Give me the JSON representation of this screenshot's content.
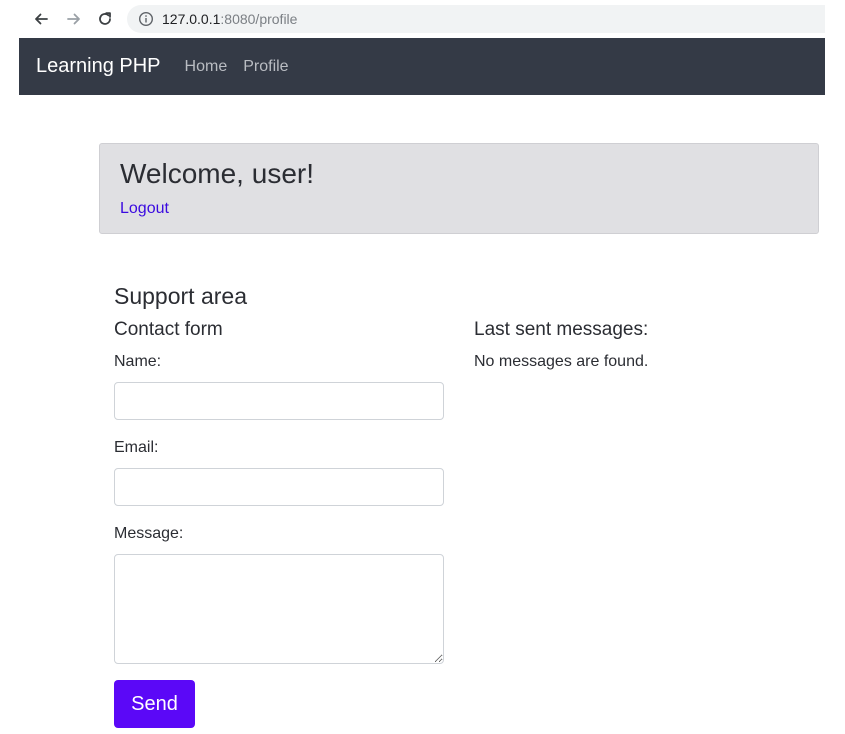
{
  "browser": {
    "url_host": "127.0.0.1",
    "url_rest": ":8080/profile",
    "back_icon": "back-arrow-icon",
    "forward_icon": "forward-arrow-icon",
    "reload_icon": "reload-icon",
    "info_icon": "info-icon"
  },
  "navbar": {
    "brand": "Learning PHP",
    "links": [
      {
        "label": "Home"
      },
      {
        "label": "Profile"
      }
    ],
    "background": "#343a46"
  },
  "welcome": {
    "title": "Welcome, user!",
    "logout_label": "Logout"
  },
  "support": {
    "title": "Support area",
    "contact_form": {
      "title": "Contact form",
      "name_label": "Name:",
      "name_value": "",
      "email_label": "Email:",
      "email_value": "",
      "message_label": "Message:",
      "message_value": "",
      "send_label": "Send"
    },
    "messages": {
      "title": "Last sent messages:",
      "empty_text": "No messages are found."
    }
  },
  "colors": {
    "accent": "#5b08f7",
    "link": "#3a0ae0"
  }
}
